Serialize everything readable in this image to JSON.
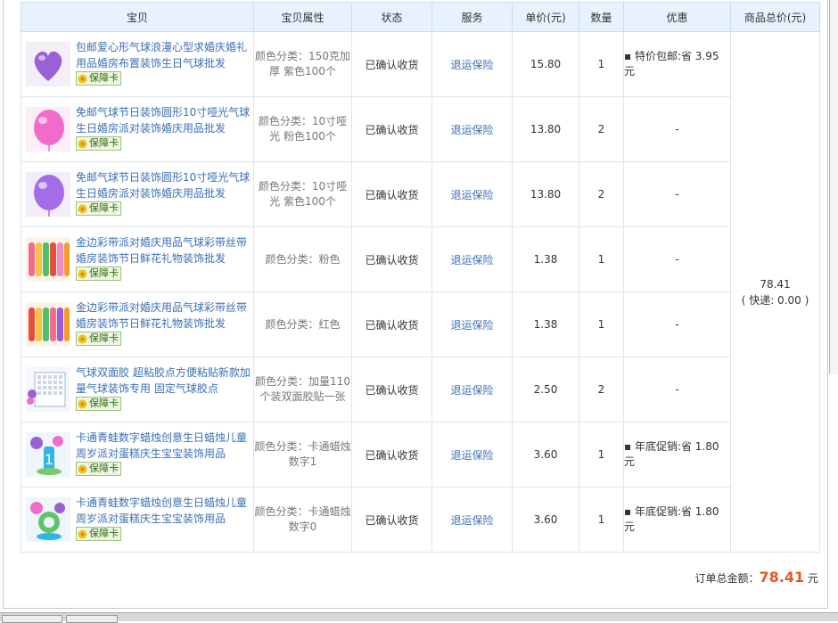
{
  "headers": {
    "item": "宝贝",
    "attr": "宝贝属性",
    "status": "状态",
    "service": "服务",
    "price": "单价(元)",
    "qty": "数量",
    "promo": "优惠",
    "total": "商品总价(元)"
  },
  "badge_label": "保障卡",
  "rows": [
    {
      "title": "包邮爱心形气球浪漫心型求婚庆婚礼用品婚房布置装饰生日气球批发",
      "attr": "颜色分类：150克加厚 紫色100个",
      "status": "已确认收货",
      "service": "退运保险",
      "price": "15.80",
      "qty": "1",
      "promo": "特价包邮:省 3.95 元"
    },
    {
      "title": "免邮气球节日装饰圆形10寸哑光气球生日婚房派对装饰婚庆用品批发",
      "attr": "颜色分类：10寸哑光 粉色100个",
      "status": "已确认收货",
      "service": "退运保险",
      "price": "13.80",
      "qty": "2",
      "promo": "-"
    },
    {
      "title": "免邮气球节日装饰圆形10寸哑光气球生日婚房派对装饰婚庆用品批发",
      "attr": "颜色分类：10寸哑光 紫色100个",
      "status": "已确认收货",
      "service": "退运保险",
      "price": "13.80",
      "qty": "2",
      "promo": "-"
    },
    {
      "title": "金边彩带派对婚庆用品气球彩带丝带婚房装饰节日鲜花礼物装饰批发",
      "attr": "颜色分类：粉色",
      "status": "已确认收货",
      "service": "退运保险",
      "price": "1.38",
      "qty": "1",
      "promo": "-"
    },
    {
      "title": "金边彩带派对婚庆用品气球彩带丝带婚房装饰节日鲜花礼物装饰批发",
      "attr": "颜色分类：红色",
      "status": "已确认收货",
      "service": "退运保险",
      "price": "1.38",
      "qty": "1",
      "promo": "-"
    },
    {
      "title": "气球双面胶 超粘胶点方便粘贴新款加量气球装饰专用 固定气球胶点",
      "attr": "颜色分类：加量110个装双面胶贴一张",
      "status": "已确认收货",
      "service": "退运保险",
      "price": "2.50",
      "qty": "2",
      "promo": "-"
    },
    {
      "title": "卡通青蛙数字蜡烛创意生日蜡烛儿童周岁派对蛋糕庆生宝宝装饰用品",
      "attr": "颜色分类：卡通蜡烛数字1",
      "status": "已确认收货",
      "service": "退运保险",
      "price": "3.60",
      "qty": "1",
      "promo": "年底促销:省 1.80 元"
    },
    {
      "title": "卡通青蛙数字蜡烛创意生日蜡烛儿童周岁派对蛋糕庆生宝宝装饰用品",
      "attr": "颜色分类：卡通蜡烛数字0",
      "status": "已确认收货",
      "service": "退运保险",
      "price": "3.60",
      "qty": "1",
      "promo": "年底促销:省 1.80 元"
    }
  ],
  "total": {
    "amount": "78.41",
    "shipping": "( 快递: 0.00 )"
  },
  "summary": {
    "label": "订单总金额：",
    "amount": "78.41",
    "unit": "元"
  },
  "colors": {
    "header_bg": "#e8f2fd",
    "link": "#3a6fb5",
    "amount": "#e4581e"
  }
}
